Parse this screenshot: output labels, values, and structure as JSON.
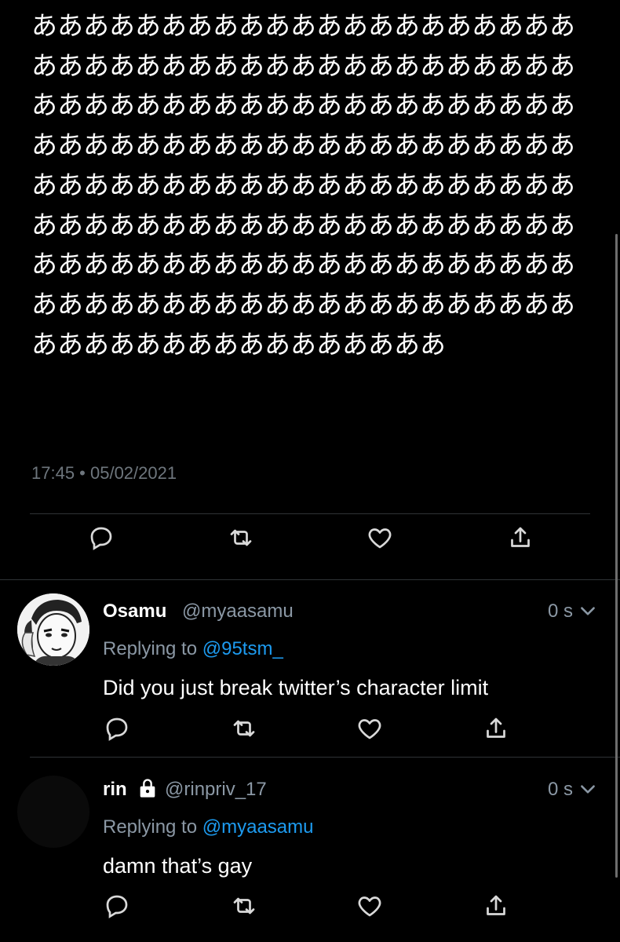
{
  "main_tweet": {
    "text": "ああああああああああああああああああああああああああああああああああああああああああああああああああああああああああああああああああああああああああああああああああああああああああああああああああああああああああああああああああああああああああああああああああああああああああああああああああああああああああああああああああああああああああああああああああああああああ",
    "timestamp": "17:45 • 05/02/2021",
    "actions": [
      "reply-icon",
      "retweet-icon",
      "like-icon",
      "share-icon"
    ]
  },
  "replies": [
    {
      "name": "Osamu",
      "handle": "@myaasamu",
      "time": "0 s",
      "replying_prefix": "Replying to ",
      "replying_to": "@95tsm_",
      "text": "Did you just break twitter’s character limit",
      "protected": false
    },
    {
      "name": "rin",
      "handle": "@rinpriv_17",
      "time": "0 s",
      "replying_prefix": "Replying to ",
      "replying_to": "@myaasamu",
      "text": "damn that’s gay",
      "protected": true
    }
  ],
  "colors": {
    "background": "#000000",
    "text": "#ffffff",
    "secondary": "#8b98a5",
    "accent": "#1d9bf0",
    "divider": "#2f3336"
  }
}
